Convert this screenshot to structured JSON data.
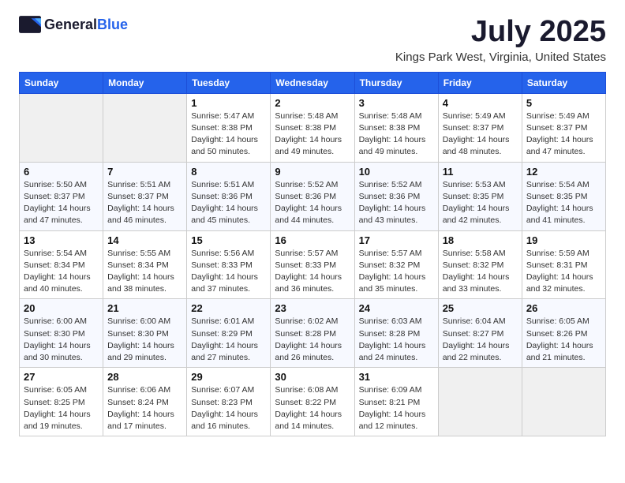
{
  "header": {
    "logo_general": "General",
    "logo_blue": "Blue",
    "month_title": "July 2025",
    "location": "Kings Park West, Virginia, United States"
  },
  "weekdays": [
    "Sunday",
    "Monday",
    "Tuesday",
    "Wednesday",
    "Thursday",
    "Friday",
    "Saturday"
  ],
  "weeks": [
    [
      {
        "day": "",
        "info": ""
      },
      {
        "day": "",
        "info": ""
      },
      {
        "day": "1",
        "info": "Sunrise: 5:47 AM\nSunset: 8:38 PM\nDaylight: 14 hours\nand 50 minutes."
      },
      {
        "day": "2",
        "info": "Sunrise: 5:48 AM\nSunset: 8:38 PM\nDaylight: 14 hours\nand 49 minutes."
      },
      {
        "day": "3",
        "info": "Sunrise: 5:48 AM\nSunset: 8:38 PM\nDaylight: 14 hours\nand 49 minutes."
      },
      {
        "day": "4",
        "info": "Sunrise: 5:49 AM\nSunset: 8:37 PM\nDaylight: 14 hours\nand 48 minutes."
      },
      {
        "day": "5",
        "info": "Sunrise: 5:49 AM\nSunset: 8:37 PM\nDaylight: 14 hours\nand 47 minutes."
      }
    ],
    [
      {
        "day": "6",
        "info": "Sunrise: 5:50 AM\nSunset: 8:37 PM\nDaylight: 14 hours\nand 47 minutes."
      },
      {
        "day": "7",
        "info": "Sunrise: 5:51 AM\nSunset: 8:37 PM\nDaylight: 14 hours\nand 46 minutes."
      },
      {
        "day": "8",
        "info": "Sunrise: 5:51 AM\nSunset: 8:36 PM\nDaylight: 14 hours\nand 45 minutes."
      },
      {
        "day": "9",
        "info": "Sunrise: 5:52 AM\nSunset: 8:36 PM\nDaylight: 14 hours\nand 44 minutes."
      },
      {
        "day": "10",
        "info": "Sunrise: 5:52 AM\nSunset: 8:36 PM\nDaylight: 14 hours\nand 43 minutes."
      },
      {
        "day": "11",
        "info": "Sunrise: 5:53 AM\nSunset: 8:35 PM\nDaylight: 14 hours\nand 42 minutes."
      },
      {
        "day": "12",
        "info": "Sunrise: 5:54 AM\nSunset: 8:35 PM\nDaylight: 14 hours\nand 41 minutes."
      }
    ],
    [
      {
        "day": "13",
        "info": "Sunrise: 5:54 AM\nSunset: 8:34 PM\nDaylight: 14 hours\nand 40 minutes."
      },
      {
        "day": "14",
        "info": "Sunrise: 5:55 AM\nSunset: 8:34 PM\nDaylight: 14 hours\nand 38 minutes."
      },
      {
        "day": "15",
        "info": "Sunrise: 5:56 AM\nSunset: 8:33 PM\nDaylight: 14 hours\nand 37 minutes."
      },
      {
        "day": "16",
        "info": "Sunrise: 5:57 AM\nSunset: 8:33 PM\nDaylight: 14 hours\nand 36 minutes."
      },
      {
        "day": "17",
        "info": "Sunrise: 5:57 AM\nSunset: 8:32 PM\nDaylight: 14 hours\nand 35 minutes."
      },
      {
        "day": "18",
        "info": "Sunrise: 5:58 AM\nSunset: 8:32 PM\nDaylight: 14 hours\nand 33 minutes."
      },
      {
        "day": "19",
        "info": "Sunrise: 5:59 AM\nSunset: 8:31 PM\nDaylight: 14 hours\nand 32 minutes."
      }
    ],
    [
      {
        "day": "20",
        "info": "Sunrise: 6:00 AM\nSunset: 8:30 PM\nDaylight: 14 hours\nand 30 minutes."
      },
      {
        "day": "21",
        "info": "Sunrise: 6:00 AM\nSunset: 8:30 PM\nDaylight: 14 hours\nand 29 minutes."
      },
      {
        "day": "22",
        "info": "Sunrise: 6:01 AM\nSunset: 8:29 PM\nDaylight: 14 hours\nand 27 minutes."
      },
      {
        "day": "23",
        "info": "Sunrise: 6:02 AM\nSunset: 8:28 PM\nDaylight: 14 hours\nand 26 minutes."
      },
      {
        "day": "24",
        "info": "Sunrise: 6:03 AM\nSunset: 8:28 PM\nDaylight: 14 hours\nand 24 minutes."
      },
      {
        "day": "25",
        "info": "Sunrise: 6:04 AM\nSunset: 8:27 PM\nDaylight: 14 hours\nand 22 minutes."
      },
      {
        "day": "26",
        "info": "Sunrise: 6:05 AM\nSunset: 8:26 PM\nDaylight: 14 hours\nand 21 minutes."
      }
    ],
    [
      {
        "day": "27",
        "info": "Sunrise: 6:05 AM\nSunset: 8:25 PM\nDaylight: 14 hours\nand 19 minutes."
      },
      {
        "day": "28",
        "info": "Sunrise: 6:06 AM\nSunset: 8:24 PM\nDaylight: 14 hours\nand 17 minutes."
      },
      {
        "day": "29",
        "info": "Sunrise: 6:07 AM\nSunset: 8:23 PM\nDaylight: 14 hours\nand 16 minutes."
      },
      {
        "day": "30",
        "info": "Sunrise: 6:08 AM\nSunset: 8:22 PM\nDaylight: 14 hours\nand 14 minutes."
      },
      {
        "day": "31",
        "info": "Sunrise: 6:09 AM\nSunset: 8:21 PM\nDaylight: 14 hours\nand 12 minutes."
      },
      {
        "day": "",
        "info": ""
      },
      {
        "day": "",
        "info": ""
      }
    ]
  ]
}
